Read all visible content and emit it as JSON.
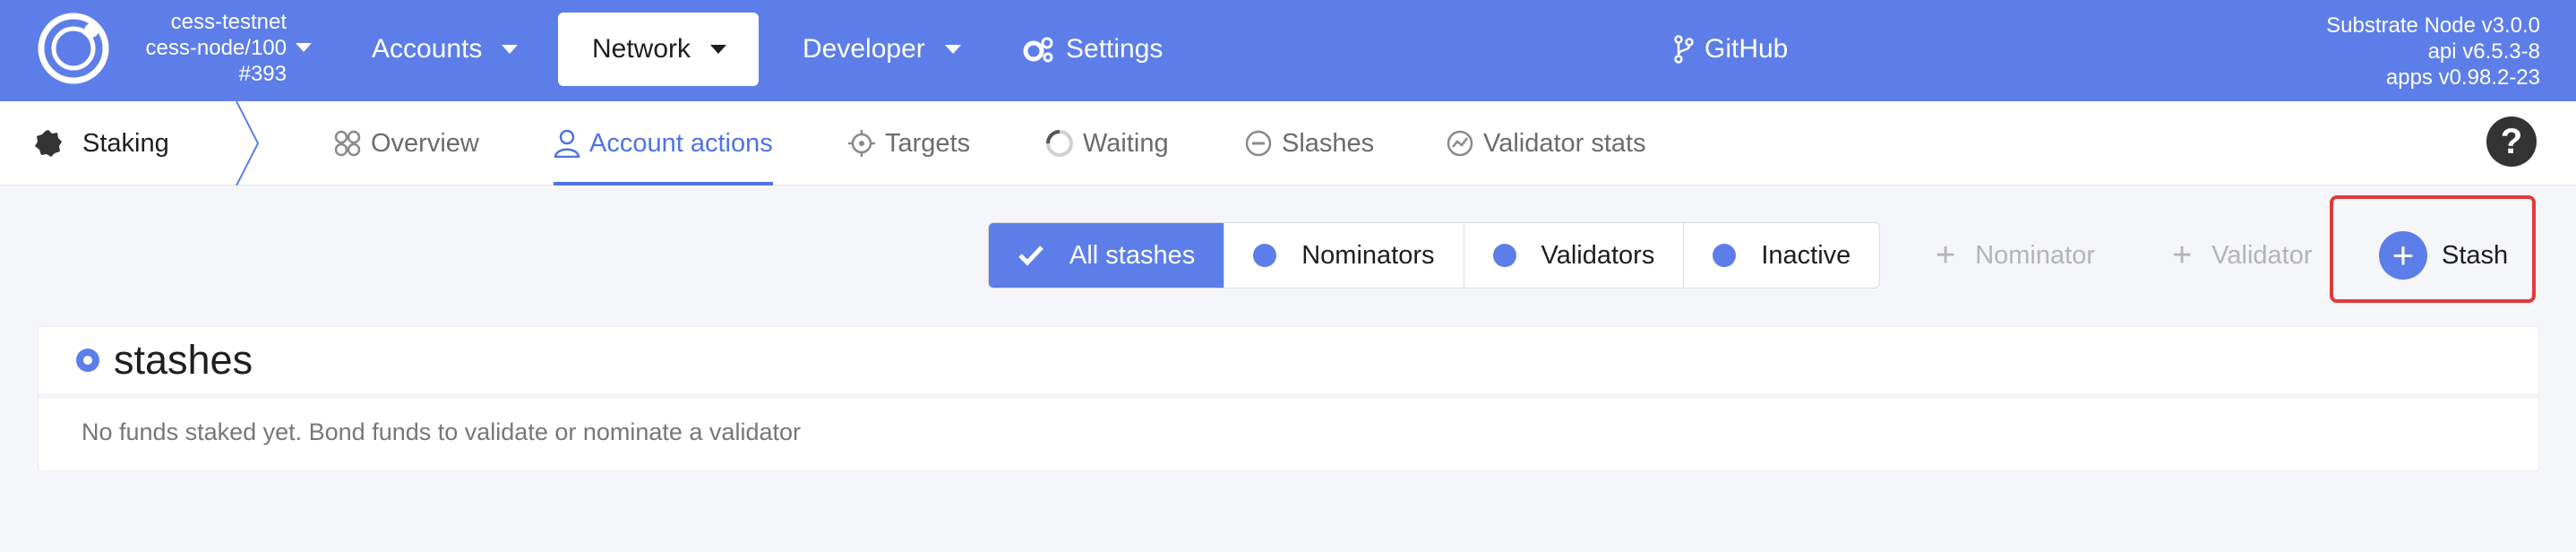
{
  "topbar": {
    "chain": {
      "name": "cess-testnet",
      "node": "cess-node/100",
      "block": "#393"
    },
    "menu": {
      "accounts": "Accounts",
      "network": "Network",
      "developer": "Developer",
      "settings": "Settings",
      "github": "GitHub"
    },
    "node_info": {
      "line1": "Substrate Node v3.0.0",
      "line2": "api v6.5.3-8",
      "line3": "apps v0.98.2-23"
    }
  },
  "subnav": {
    "title": "Staking",
    "tabs": [
      {
        "label": "Overview",
        "icon": "overview-icon"
      },
      {
        "label": "Account actions",
        "icon": "user-icon",
        "active": true
      },
      {
        "label": "Targets",
        "icon": "crosshair-icon"
      },
      {
        "label": "Waiting",
        "icon": "spinner-icon"
      },
      {
        "label": "Slashes",
        "icon": "minus-circle-icon"
      },
      {
        "label": "Validator stats",
        "icon": "chart-icon"
      }
    ],
    "help_icon": "question-icon"
  },
  "filters": [
    {
      "label": "All stashes",
      "active": true
    },
    {
      "label": "Nominators"
    },
    {
      "label": "Validators"
    },
    {
      "label": "Inactive"
    }
  ],
  "actions": {
    "nominator": "Nominator",
    "validator": "Validator",
    "stash": "Stash"
  },
  "stashes": {
    "title": "stashes",
    "empty_message": "No funds staked yet. Bond funds to validate or nominate a validator"
  },
  "colors": {
    "brand": "#5d7ee8",
    "accent": "#4f73e3",
    "highlight_border": "#e03b3b"
  }
}
